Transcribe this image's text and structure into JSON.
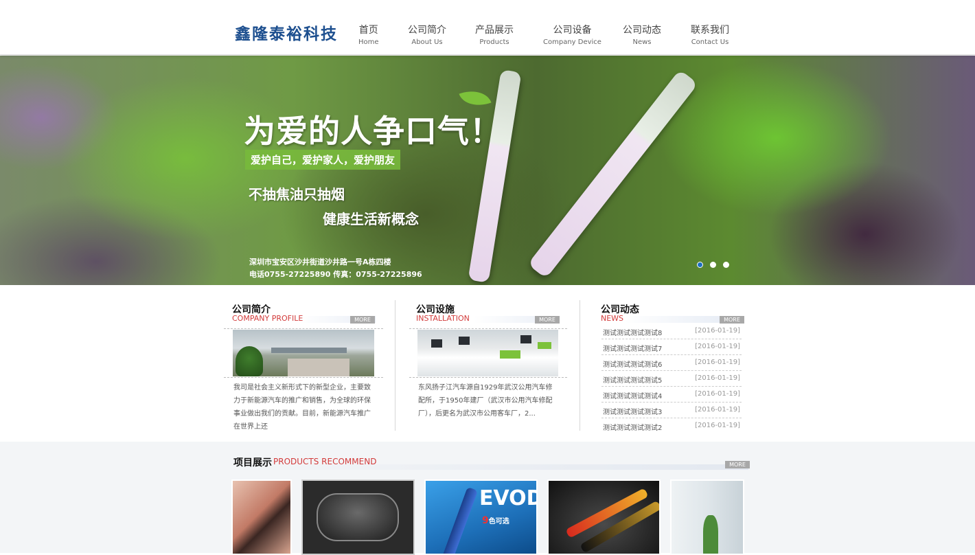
{
  "logo": {
    "text": "鑫隆泰裕科技"
  },
  "nav": [
    {
      "cn": "首页",
      "en": "Home"
    },
    {
      "cn": "公司简介",
      "en": "About Us"
    },
    {
      "cn": "产品展示",
      "en": "Products"
    },
    {
      "cn": "公司设备",
      "en": "Company Device"
    },
    {
      "cn": "公司动态",
      "en": "News"
    },
    {
      "cn": "联系我们",
      "en": "Contact Us"
    }
  ],
  "banner": {
    "headline": "为爱的人争口气！",
    "tagline": "爱护自己，爱护家人，爱护朋友",
    "slogan1": "不抽焦油只抽烟",
    "slogan2": "健康生活新概念",
    "address": "深圳市宝安区沙井街道沙井路一号A栋四楼",
    "phone": "电话0755-27225890  传真：0755-27225896",
    "slides": 3,
    "active_slide": 1
  },
  "profile": {
    "title": "公司简介",
    "subtitle": "COMPANY PROFILE",
    "more": "MORE",
    "text": "我司是社会主义新形式下的新型企业，主要致力于新能源汽车的推广和销售，为全球的环保事业做出我们的贡献。目前，新能源汽车推广在世界上还"
  },
  "facility": {
    "title": "公司设施",
    "subtitle": "INSTALLATION",
    "more": "MORE",
    "text": "东风扬子江汽车源自1929年武汉公用汽车修配所，于1950年建厂（武汉市公用汽车修配厂），后更名为武汉市公用客车厂，2..."
  },
  "news": {
    "title": "公司动态",
    "subtitle": "NEWS",
    "more": "MORE",
    "items": [
      {
        "title": "测试测试测试测试8",
        "date": "[2016-01-19]"
      },
      {
        "title": "测试测试测试测试7",
        "date": "[2016-01-19]"
      },
      {
        "title": "测试测试测试测试6",
        "date": "[2016-01-19]"
      },
      {
        "title": "测试测试测试测试5",
        "date": "[2016-01-19]"
      },
      {
        "title": "测试测试测试测试4",
        "date": "[2016-01-19]"
      },
      {
        "title": "测试测试测试测试3",
        "date": "[2016-01-19]"
      },
      {
        "title": "测试测试测试测试2",
        "date": "[2016-01-19]"
      }
    ]
  },
  "projects": {
    "title": "项目展示",
    "subtitle": "PRODUCTS RECOMMEND",
    "more": "MORE",
    "evod": "EVOD",
    "evod_count": "9",
    "evod_caption": "色可选"
  },
  "colors": {
    "accent_red": "#d23a3a",
    "dot_active": "#1e6fc1",
    "banner_green": "#78b93c",
    "logo_blue": "#1d4f8f"
  }
}
